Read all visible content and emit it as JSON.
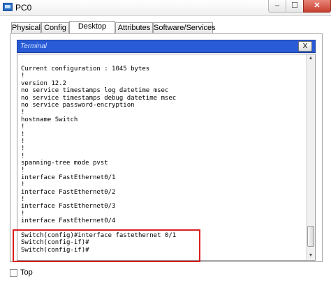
{
  "window": {
    "title": "PC0",
    "minimize_label": "–",
    "maximize_label": "☐",
    "close_label": "✕"
  },
  "tabs": [
    {
      "label": "Physical",
      "active": false
    },
    {
      "label": "Config",
      "active": false
    },
    {
      "label": "Desktop",
      "active": true
    },
    {
      "label": "Attributes",
      "active": false
    },
    {
      "label": "Software/Services",
      "active": false
    }
  ],
  "terminal": {
    "title": "Terminal",
    "close_label": "X",
    "lines": [
      "Current configuration : 1045 bytes",
      "!",
      "version 12.2",
      "no service timestamps log datetime msec",
      "no service timestamps debug datetime msec",
      "no service password-encryption",
      "!",
      "hostname Switch",
      "!",
      "!",
      "!",
      "!",
      "!",
      "spanning-tree mode pvst",
      "!",
      "interface FastEthernet0/1",
      "!",
      "interface FastEthernet0/2",
      "!",
      "interface FastEthernet0/3",
      "!",
      "interface FastEthernet0/4",
      "",
      "Switch(config)#interface fastethernet 0/1",
      "Switch(config-if)#",
      "Switch(config-if)#"
    ]
  },
  "bottom": {
    "top_label": "Top"
  },
  "colors": {
    "terminal_header": "#2a5bd6",
    "highlight": "#d9201f"
  }
}
